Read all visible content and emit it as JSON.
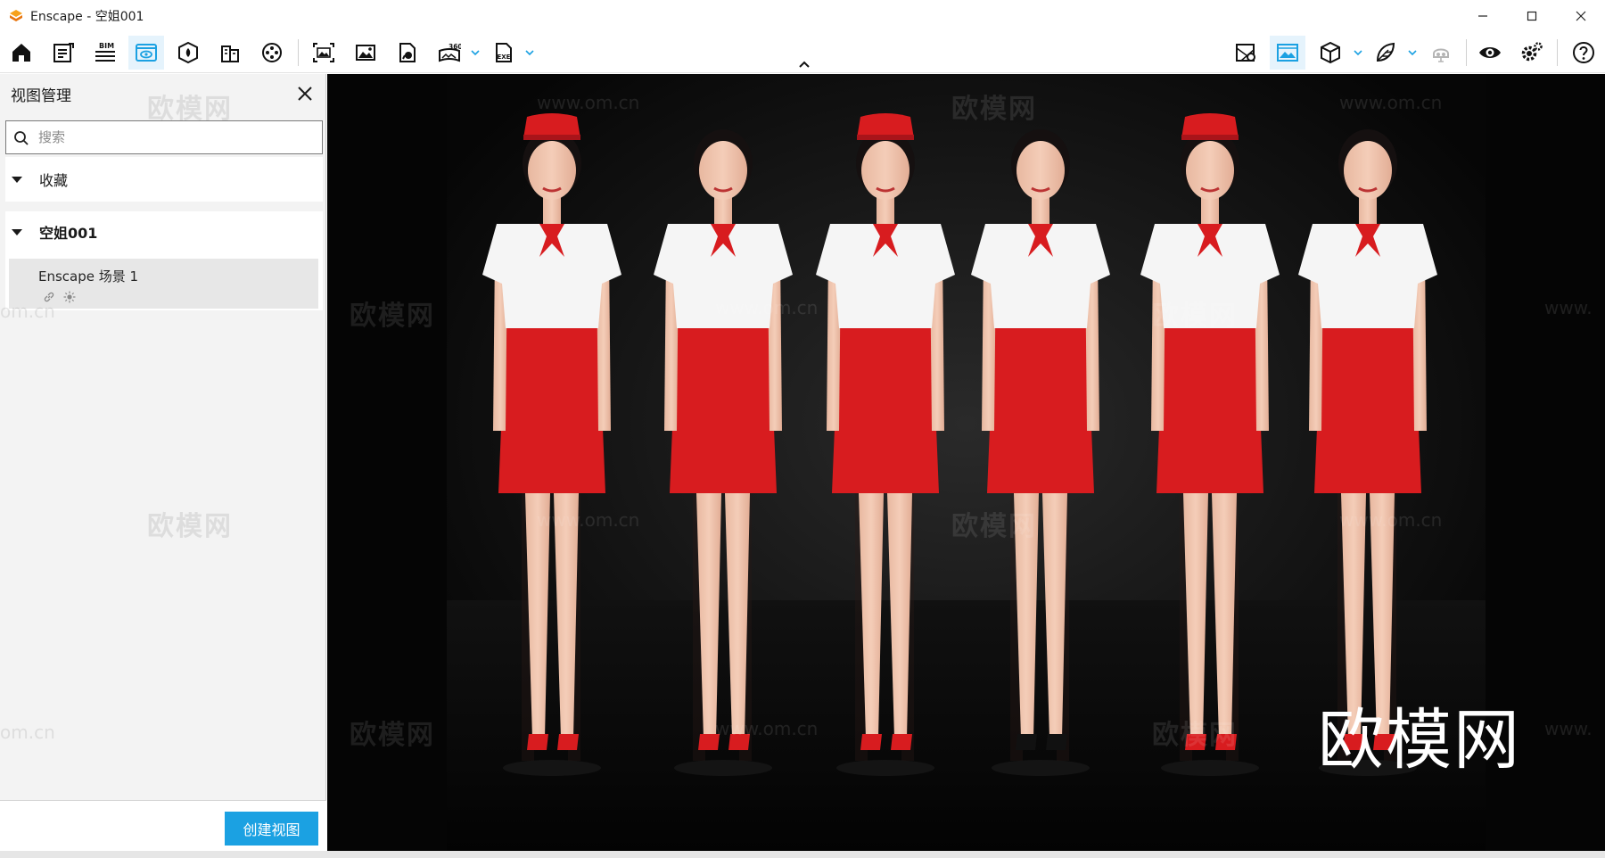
{
  "window": {
    "title": "Enscape - 空姐001"
  },
  "toolbar": {
    "bim_label": "BIM",
    "video360_label": "360",
    "exe_label": "EXE"
  },
  "panel": {
    "title": "视图管理",
    "search_placeholder": "搜索",
    "groups": [
      {
        "label": "收藏"
      },
      {
        "label": "空姐001",
        "views": [
          {
            "name": "Enscape 场景 1"
          }
        ]
      }
    ],
    "create_button": "创建视图"
  },
  "viewport": {
    "watermark_text": "欧模网",
    "watermark_url": "www.om.cn",
    "watermark_url_partial": "om.cn",
    "watermark_url_trailing": "www."
  },
  "colors": {
    "accent": "#1ba1e2",
    "skirt_red": "#d81c1f",
    "background": "#070707"
  }
}
